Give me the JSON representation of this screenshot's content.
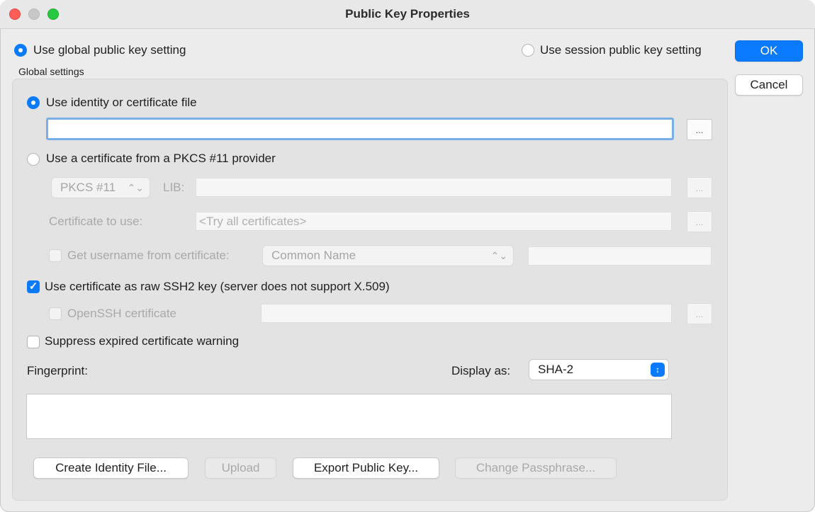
{
  "window": {
    "title": "Public Key Properties"
  },
  "top": {
    "use_global_label": "Use global public key setting",
    "use_session_label": "Use session public key setting",
    "group_label": "Global settings"
  },
  "buttons": {
    "ok": "OK",
    "cancel": "Cancel"
  },
  "identity": {
    "use_identity_label": "Use identity or certificate file",
    "file_value": "",
    "browse": "..."
  },
  "pkcs": {
    "use_pkcs_label": "Use a certificate from a PKCS #11 provider",
    "provider_select": "PKCS #11",
    "lib_label": "LIB:",
    "lib_value": "",
    "browse": "...",
    "certificate_to_use_label": "Certificate to use:",
    "certificate_placeholder": "<Try all certificates>",
    "get_username_label": "Get username from certificate:",
    "username_field_select": "Common Name",
    "username_value": ""
  },
  "raw": {
    "use_raw_label": "Use certificate as raw SSH2 key (server does not support X.509)",
    "openssh_label": "OpenSSH certificate",
    "openssh_value": "",
    "browse": "..."
  },
  "suppress_label": "Suppress expired certificate warning",
  "fingerprint": {
    "label": "Fingerprint:",
    "display_as_label": "Display as:",
    "display_as_value": "SHA-2",
    "value": ""
  },
  "actions": {
    "create_identity": "Create Identity File...",
    "upload": "Upload",
    "export_public_key": "Export Public Key...",
    "change_passphrase": "Change Passphrase..."
  },
  "state": {
    "global_selected": true,
    "identity_selected": true,
    "raw_checked": true,
    "suppress_checked": false,
    "accent_color": "#0a7aff"
  }
}
